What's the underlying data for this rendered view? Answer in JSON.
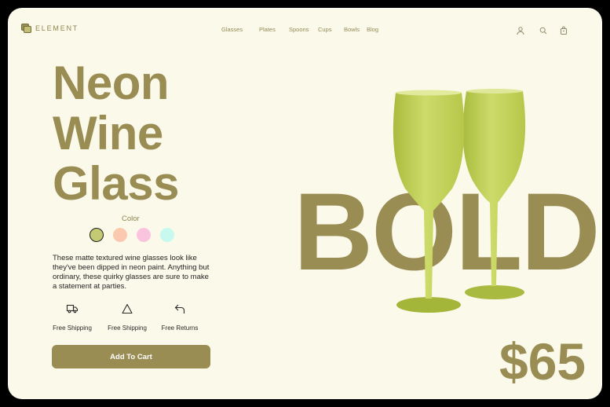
{
  "brand": {
    "name": "ELEMENT"
  },
  "nav": {
    "items": [
      "Glasses",
      "Plates",
      "Spoons",
      "Cups",
      "Bowls",
      "Blog"
    ]
  },
  "header_icons": [
    "user-icon",
    "search-icon",
    "cart-icon"
  ],
  "hero": {
    "title_lines": [
      "Neon",
      "Wine",
      "Glass"
    ],
    "background_word": "BOLD",
    "price": "$65"
  },
  "color_picker": {
    "label": "Color",
    "swatches": [
      "#c3ca73",
      "#fbc9b0",
      "#fbc4de",
      "#c8f9ef"
    ],
    "selected_index": 0
  },
  "description": "These matte textured wine glasses look like they've been dipped in neon paint. Anything but ordinary, these quirky glasses are sure to make a statement at parties.",
  "features": [
    {
      "icon": "truck-icon",
      "label": "Free Shipping"
    },
    {
      "icon": "triangle-icon",
      "label": "Free Shipping"
    },
    {
      "icon": "return-arrow-icon",
      "label": "Free Returns"
    }
  ],
  "cta": {
    "label": "Add To Cart"
  },
  "colors": {
    "accent": "#9a8d54",
    "background": "#fbf9ea",
    "glass": "#c3d45a"
  }
}
